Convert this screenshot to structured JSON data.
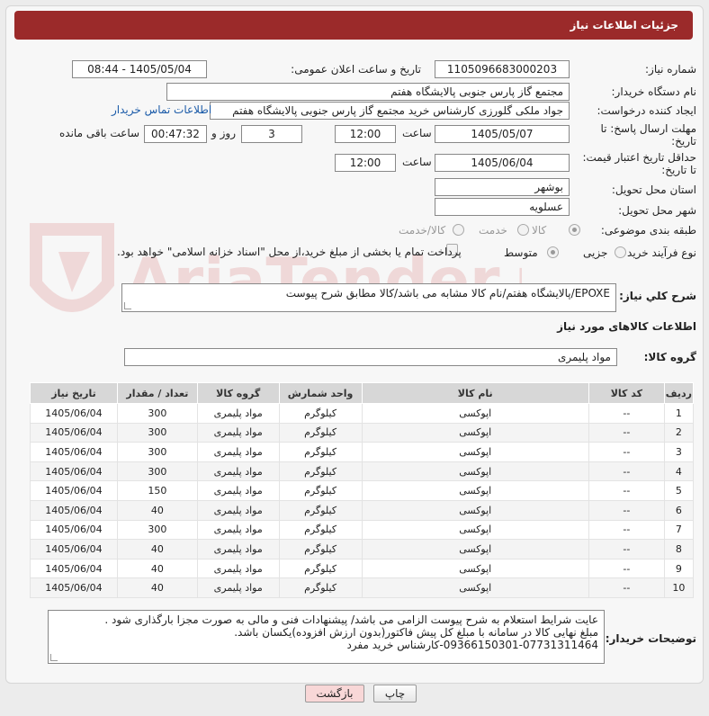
{
  "header": {
    "title": "جزئیات اطلاعات نیاز"
  },
  "form": {
    "need_number": {
      "label": "شماره نیاز:",
      "value": "1105096683000203"
    },
    "announce_datetime": {
      "label": "تاریخ و ساعت اعلان عمومی:",
      "value": "1405/05/04 - 08:44"
    },
    "buyer_org": {
      "label": "نام دستگاه خریدار:",
      "value": "مجتمع گاز پارس جنوبی  پالایشگاه هفتم"
    },
    "requester": {
      "label": "ایجاد کننده درخواست:",
      "value": "جواد ملکی گلورزی کارشناس خرید مجتمع گاز پارس جنوبی  پالایشگاه هفتم",
      "contact_link": "اطلاعات تماس خریدار"
    },
    "send_deadline": {
      "label": "مهلت ارسال پاسخ: تا تاریخ:",
      "date": "1405/05/07",
      "time_label": "ساعت",
      "time": "12:00",
      "days": "3",
      "days_label": "روز و",
      "remaining": "00:47:32",
      "remaining_label": "ساعت باقی مانده"
    },
    "price_validity": {
      "label": "حداقل تاریخ اعتبار قیمت: تا تاریخ:",
      "date": "1405/06/04",
      "time_label": "ساعت",
      "time": "12:00"
    },
    "delivery_province": {
      "label": "استان محل تحویل:",
      "value": "بوشهر"
    },
    "delivery_city": {
      "label": "شهر محل تحویل:",
      "value": "عسلویه"
    },
    "category": {
      "label": "طبقه بندی موضوعی:",
      "options": [
        "کالا",
        "خدمت",
        "کالا/خدمت"
      ],
      "selected": "کالا"
    },
    "process_type": {
      "label": "نوع فرآیند خرید :",
      "options": [
        "جزیی",
        "متوسط"
      ],
      "selected": "متوسط",
      "payment_note": "پرداخت تمام یا بخشی از مبلغ خرید،از محل \"اسناد خزانه اسلامی\" خواهد بود."
    }
  },
  "description": {
    "label": "شرح کلي نياز:",
    "value": "EPOXE/پالایشگاه هفتم/نام کالا مشابه می باشد/کالا مطابق شرح پیوست"
  },
  "goods": {
    "section_title": "اطلاعات کالاهای مورد نیاز",
    "group_label": "گروه کالا:",
    "group_value": "مواد پلیمری",
    "columns": [
      "ردیف",
      "کد کالا",
      "نام کالا",
      "واحد شمارش",
      "گروه کالا",
      "تعداد / مقدار",
      "تاریخ نیاز"
    ],
    "rows": [
      [
        "1",
        "--",
        "اپوکسی",
        "کیلوگرم",
        "مواد پلیمری",
        "300",
        "1405/06/04"
      ],
      [
        "2",
        "--",
        "اپوکسی",
        "کیلوگرم",
        "مواد پلیمری",
        "300",
        "1405/06/04"
      ],
      [
        "3",
        "--",
        "اپوکسی",
        "کیلوگرم",
        "مواد پلیمری",
        "300",
        "1405/06/04"
      ],
      [
        "4",
        "--",
        "اپوکسی",
        "کیلوگرم",
        "مواد پلیمری",
        "300",
        "1405/06/04"
      ],
      [
        "5",
        "--",
        "اپوکسی",
        "کیلوگرم",
        "مواد پلیمری",
        "150",
        "1405/06/04"
      ],
      [
        "6",
        "--",
        "اپوکسی",
        "کیلوگرم",
        "مواد پلیمری",
        "40",
        "1405/06/04"
      ],
      [
        "7",
        "--",
        "اپوکسی",
        "کیلوگرم",
        "مواد پلیمری",
        "300",
        "1405/06/04"
      ],
      [
        "8",
        "--",
        "اپوکسی",
        "کیلوگرم",
        "مواد پلیمری",
        "40",
        "1405/06/04"
      ],
      [
        "9",
        "--",
        "اپوکسی",
        "کیلوگرم",
        "مواد پلیمری",
        "40",
        "1405/06/04"
      ],
      [
        "10",
        "--",
        "اپوکسی",
        "کیلوگرم",
        "مواد پلیمری",
        "40",
        "1405/06/04"
      ]
    ]
  },
  "buyer_notes": {
    "label": "توضیحات خریدار:",
    "lines": [
      "عایت شرایط استعلام به شرح پیوست الزامی می باشد/ پیشنهادات فنی و مالی به صورت مجزا بارگذاری شود .",
      "مبلغ نهایی کالا در سامانه با مبلغ کل پیش فاکتور(بدون ارزش افزوده)یکسان باشد.",
      "09366150301-07731311464-کارشناس خرید مفرد"
    ]
  },
  "buttons": {
    "print": "چاپ",
    "back": "بازگشت"
  },
  "watermark": {
    "text": "AriaTender.net"
  },
  "colors": {
    "header_bg": "#9b2a2a",
    "back_button_bg": "#f8d7d7",
    "link": "#1a5aa8"
  }
}
